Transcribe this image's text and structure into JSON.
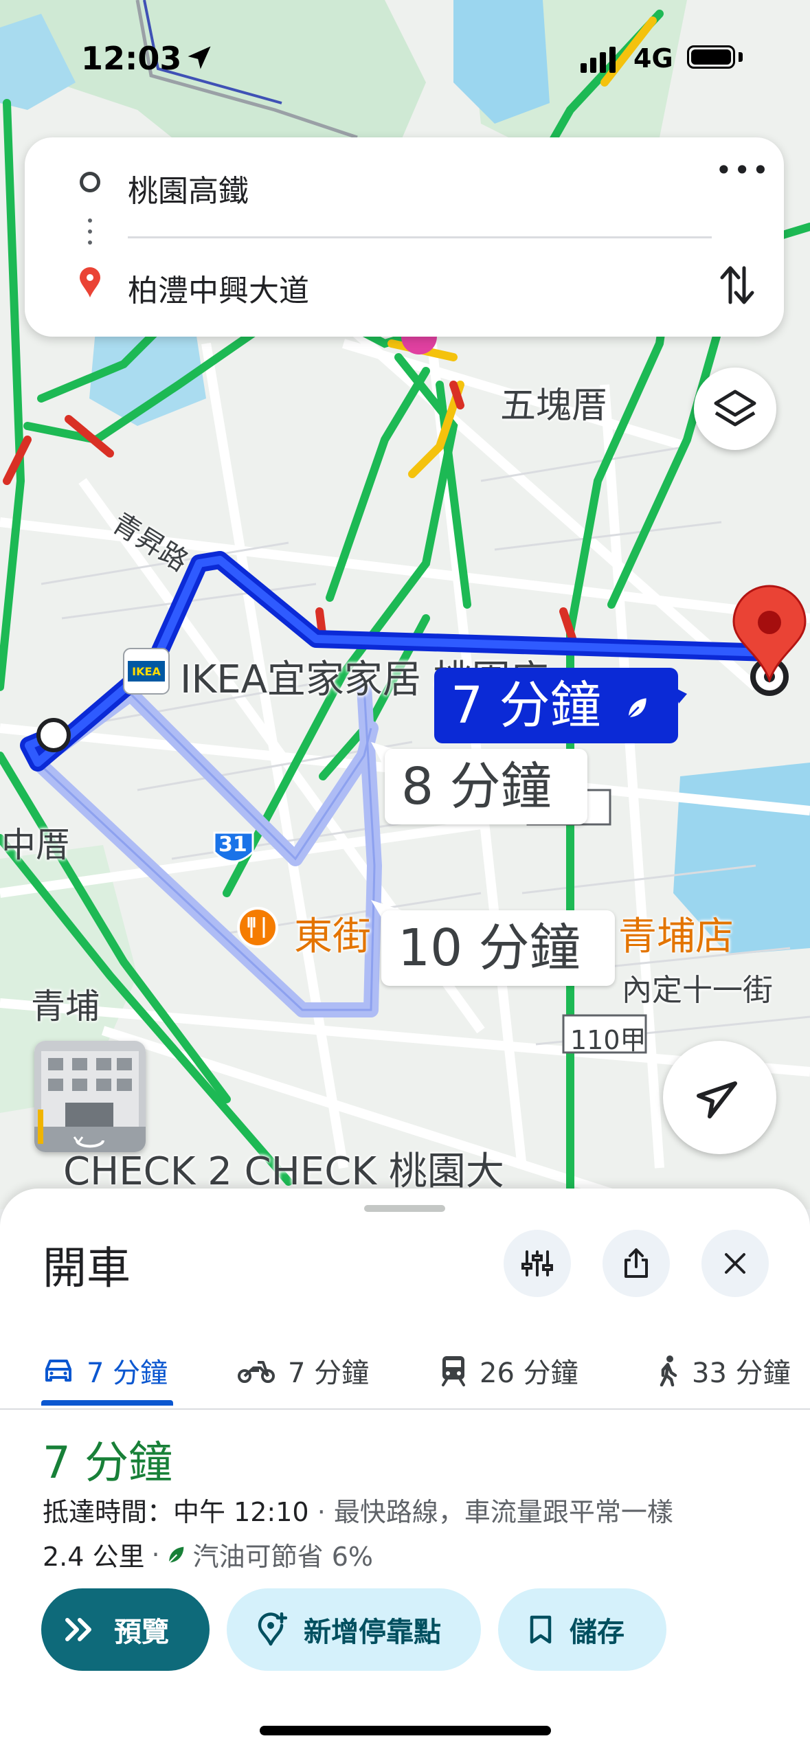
{
  "status_bar": {
    "time": "12:03",
    "network": "4G"
  },
  "search": {
    "origin": "桃園高鐵",
    "destination": "柏澧中興大道",
    "more_label": "•••"
  },
  "map": {
    "labels": {
      "wukuicuo": "五塊厝",
      "qingchang_rd": "青昇路",
      "ikea": "IKEA宜家家居 桃園店",
      "zhongcuo": "中厝",
      "qingpu": "青埔",
      "dongjie": "東街",
      "dongjie_suffix": "青埔店",
      "neiding": "內定十一街",
      "road_110a": "110甲",
      "road_31": "31",
      "check2check": "CHECK 2 CHECK 桃園大",
      "ikea_logo": "IKEA"
    },
    "route_bubbles": {
      "main": "7 分鐘",
      "alt1": "8 分鐘",
      "alt2": "10 分鐘"
    },
    "colors": {
      "primary_route": "#0b2ad6",
      "alt_route": "#aebcf5",
      "traffic_green": "#1db954",
      "traffic_yellow": "#f4c20d",
      "traffic_red": "#d93025"
    }
  },
  "sheet": {
    "title": "開車",
    "tabs": [
      {
        "mode": "drive",
        "icon": "car-icon",
        "label": "7 分鐘",
        "active": true
      },
      {
        "mode": "motorcycle",
        "icon": "motorcycle-icon",
        "label": "7 分鐘",
        "active": false
      },
      {
        "mode": "transit",
        "icon": "train-icon",
        "label": "26 分鐘",
        "active": false
      },
      {
        "mode": "walk",
        "icon": "walk-icon",
        "label": "33 分鐘",
        "active": false
      }
    ],
    "route": {
      "time": "7 分鐘",
      "arrival_label": "抵達時間：中午 12:10",
      "arrival_detail": "· 最快路線，車流量跟平常一樣",
      "distance": "2.4 公里",
      "fuel_saving": "汽油可節省 6%"
    },
    "actions": {
      "preview": "預覽",
      "add_stop": "新增停靠點",
      "save": "儲存"
    }
  }
}
